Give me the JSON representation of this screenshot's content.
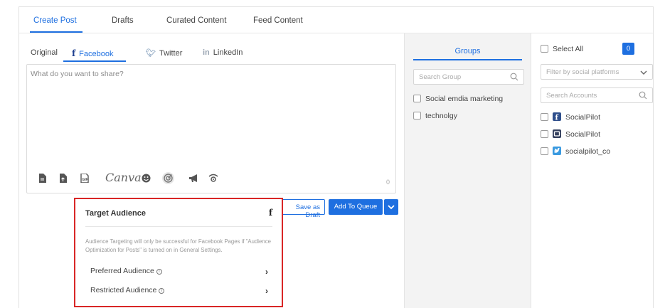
{
  "top_tabs": [
    {
      "label": "Create Post",
      "active": true
    },
    {
      "label": "Drafts",
      "active": false
    },
    {
      "label": "Curated Content",
      "active": false
    },
    {
      "label": "Feed Content",
      "active": false
    }
  ],
  "composer": {
    "tabs": [
      {
        "label": "Original",
        "icon": ""
      },
      {
        "label": "Facebook",
        "icon": "facebook-icon"
      },
      {
        "label": "Twitter",
        "icon": "twitter-icon"
      },
      {
        "label": "LinkedIn",
        "icon": "linkedin-icon"
      }
    ],
    "placeholder": "What do you want to share?",
    "char_count": "0",
    "canva_label": "Canva",
    "toolbar_icons": [
      "file-icon",
      "file-upload-icon",
      "gif-icon",
      "canva-icon",
      "emoji-icon",
      "target-icon",
      "megaphone-icon",
      "wifi-camera-icon"
    ]
  },
  "actions": {
    "save_draft": "Save as Draft",
    "add_to_queue": "Add To Queue"
  },
  "audience_popup": {
    "title": "Target Audience",
    "note": "Audience Targeting will only be successful for Facebook Pages if \"Audience Optimization for Posts\" is turned on in General Settings.",
    "preferred": "Preferred Audience",
    "restricted": "Restricted Audience"
  },
  "groups": {
    "heading": "Groups",
    "search_placeholder": "Search Group",
    "items": [
      "Social emdia marketing",
      "technolgy"
    ]
  },
  "accounts": {
    "select_all": "Select All",
    "selected_count": "0",
    "filter_placeholder": "Filter by social platforms",
    "search_placeholder": "Search Accounts",
    "items": [
      {
        "name": "SocialPilot",
        "platform": "facebook"
      },
      {
        "name": "SocialPilot",
        "platform": "instagram"
      },
      {
        "name": "socialpilot_co",
        "platform": "twitter"
      }
    ]
  },
  "colors": {
    "accent": "#1e6fe0",
    "highlight_border": "#d92626",
    "panel_bg": "#f3f3f3"
  }
}
